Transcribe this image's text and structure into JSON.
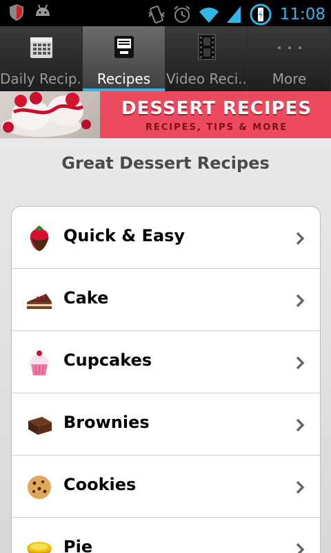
{
  "status_bar": {
    "time": "11:08",
    "icons": [
      "shield-icon",
      "android-icon",
      "vibrate-icon",
      "alarm-icon",
      "wifi-icon",
      "signal-icon",
      "charging-icon"
    ]
  },
  "tabs": [
    {
      "label": "Daily Recip..",
      "icon": "calendar-icon",
      "active": false
    },
    {
      "label": "Recipes",
      "icon": "inbox-tray-icon",
      "active": true
    },
    {
      "label": "Video Reci..",
      "icon": "film-icon",
      "active": false
    },
    {
      "label": "More",
      "icon": "more-dots-icon",
      "active": false
    }
  ],
  "banner": {
    "title": "DESSERT RECIPES",
    "subtitle": "RECIPES, TIPS & MORE",
    "accent_color": "#ed4a5f"
  },
  "main": {
    "title": "Great Dessert Recipes",
    "items": [
      {
        "label": "Quick & Easy",
        "icon": "chocolate-strawberry-icon"
      },
      {
        "label": "Cake",
        "icon": "cake-slice-icon"
      },
      {
        "label": "Cupcakes",
        "icon": "cupcake-icon"
      },
      {
        "label": "Brownies",
        "icon": "brownie-icon"
      },
      {
        "label": "Cookies",
        "icon": "cookie-icon"
      },
      {
        "label": "Pie",
        "icon": "pie-icon"
      }
    ]
  },
  "colors": {
    "highlight": "#33b5e5",
    "tab_bar": "#1e1e1e"
  }
}
